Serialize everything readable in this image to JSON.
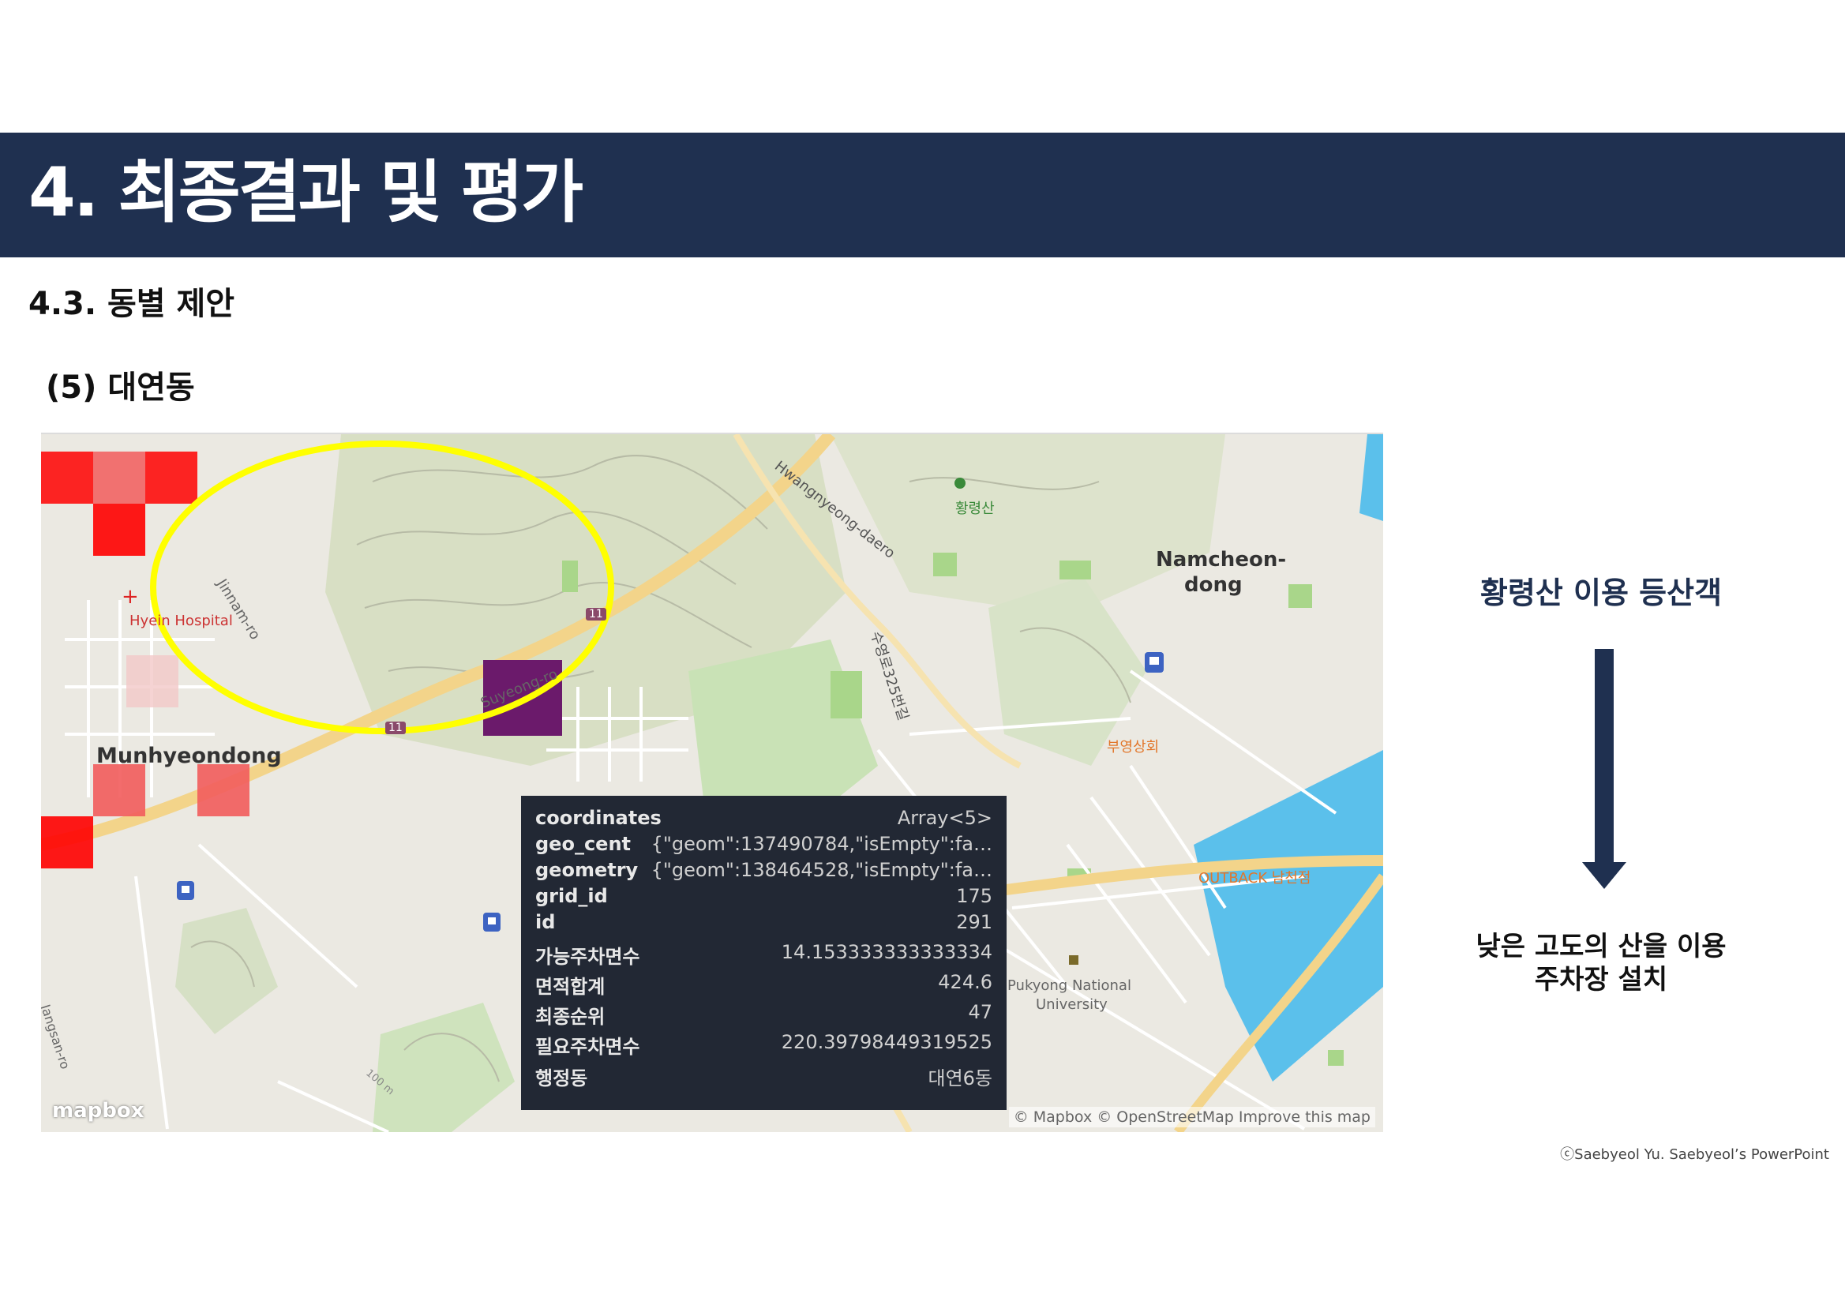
{
  "slide": {
    "title": "4. 최종결과 및 평가",
    "section": "4.3. 동별 제안",
    "subsection": "(5) 대연동",
    "copyright": "ⓒSaebyeol Yu. Saebyeol’s PowerPoint"
  },
  "map": {
    "labels": {
      "hyein_hospital": "Hyein Hospital",
      "jinnam_ro": "Jinnam-ro",
      "munhyeondong": "Munhyeondong",
      "suyeong_ro": "Suyeong-ro",
      "hwangnyeong_daero": "Hwangnyeong-daero",
      "hwangnyeongsan": "황령산",
      "namcheon_dong_1": "Namcheon-",
      "namcheon_dong_2": "dong",
      "bueong_store": "부영상회",
      "outback": "OUTBACK 남천점",
      "pukyong_1": "Pukyong National",
      "pukyong_2": "University",
      "road_11_a": "11",
      "road_11_b": "11",
      "road_vertical": "수영로325번길",
      "jangsan": "Jangsan-ro",
      "contour_100": "100 m"
    },
    "attribution": "© Mapbox © OpenStreetMap Improve this map",
    "logo": "mapbox",
    "highlight_color": "#ffff00",
    "cell_colors": {
      "high": "#ff0000",
      "mid": "#f25c5c",
      "low": "#f2c8c8",
      "selected": "#6b1a6b"
    }
  },
  "tooltip": {
    "rows": [
      {
        "key": "coordinates",
        "value": "Array<5>"
      },
      {
        "key": "geo_cent",
        "value": "{\"geom\":137490784,\"isEmpty\":fa…"
      },
      {
        "key": "geometry",
        "value": "{\"geom\":138464528,\"isEmpty\":fa…"
      },
      {
        "key": "grid_id",
        "value": "175"
      },
      {
        "key": "id",
        "value": "291"
      },
      {
        "key": "가능주차면수",
        "value": "14.153333333333334"
      },
      {
        "key": "면적합계",
        "value": "424.6"
      },
      {
        "key": "최종순위",
        "value": "47"
      },
      {
        "key": "필요주차면수",
        "value": "220.39798449319525"
      },
      {
        "key": "행정동",
        "value": "대연6동"
      }
    ]
  },
  "side": {
    "heading": "황령산 이용 등산객",
    "result_line1": "낮은 고도의 산을 이용",
    "result_line2": "주차장 설치",
    "arrow_color": "#1f3050"
  }
}
